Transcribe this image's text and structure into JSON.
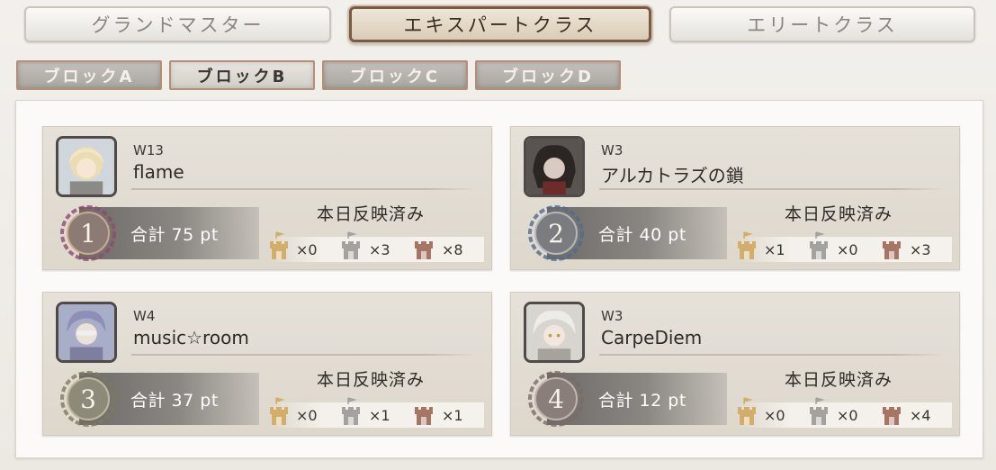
{
  "top_tabs": [
    {
      "label": "グランドマスター",
      "active": false
    },
    {
      "label": "エキスパートクラス",
      "active": true
    },
    {
      "label": "エリートクラス",
      "active": false
    }
  ],
  "block_tabs": [
    {
      "label": "ブロックA",
      "active": false
    },
    {
      "label": "ブロックB",
      "active": true
    },
    {
      "label": "ブロックC",
      "active": false
    },
    {
      "label": "ブロックD",
      "active": false
    }
  ],
  "entries": [
    {
      "rank": "1",
      "world": "W13",
      "name": "flame",
      "total": "合計 75 pt",
      "status": "本日反映済み",
      "castles": [
        {
          "color": "gold",
          "count": "×0"
        },
        {
          "color": "silver",
          "count": "×3"
        },
        {
          "color": "bronze",
          "count": "×8"
        }
      ],
      "medal_color": "#8d4a6f"
    },
    {
      "rank": "2",
      "world": "W3",
      "name": "アルカトラズの鎖",
      "total": "合計 40 pt",
      "status": "本日反映済み",
      "castles": [
        {
          "color": "gold",
          "count": "×1"
        },
        {
          "color": "silver",
          "count": "×0"
        },
        {
          "color": "bronze",
          "count": "×3"
        }
      ],
      "medal_color": "#4f6c8e"
    },
    {
      "rank": "3",
      "world": "W4",
      "name": "music☆room",
      "total": "合計 37 pt",
      "status": "本日反映済み",
      "castles": [
        {
          "color": "gold",
          "count": "×0"
        },
        {
          "color": "silver",
          "count": "×1"
        },
        {
          "color": "bronze",
          "count": "×1"
        }
      ],
      "medal_color": "#7c7a5c"
    },
    {
      "rank": "4",
      "world": "W3",
      "name": "CarpeDiem",
      "total": "合計 12 pt",
      "status": "本日反映済み",
      "castles": [
        {
          "color": "gold",
          "count": "×0"
        },
        {
          "color": "silver",
          "count": "×0"
        },
        {
          "color": "bronze",
          "count": "×4"
        }
      ],
      "medal_color": "#7a6a66"
    }
  ],
  "colors": {
    "castle_gold": "#d2ae6a",
    "castle_silver": "#a3a29f",
    "castle_bronze": "#a67563"
  }
}
